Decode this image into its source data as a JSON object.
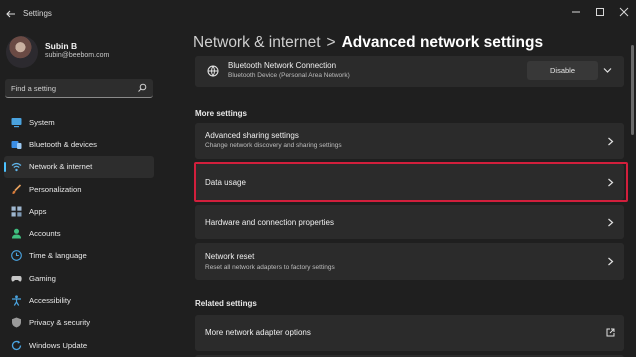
{
  "window": {
    "title": "Settings",
    "back_icon": "back-arrow-icon",
    "controls": [
      "minimize",
      "maximize",
      "close"
    ]
  },
  "profile": {
    "name": "Subin B",
    "email": "subin@beebom.com"
  },
  "search": {
    "placeholder": "Find a setting"
  },
  "sidebar": {
    "items": [
      {
        "label": "System",
        "icon": "monitor-icon",
        "color": "#4aa3df"
      },
      {
        "label": "Bluetooth & devices",
        "icon": "bluetooth-icon",
        "color": "#3a8ee6"
      },
      {
        "label": "Network & internet",
        "icon": "wifi-icon",
        "color": "#5fb3e8",
        "active": true
      },
      {
        "label": "Personalization",
        "icon": "paintbrush-icon",
        "color": "#e8a25f"
      },
      {
        "label": "Apps",
        "icon": "apps-icon",
        "color": "#9fb7cf"
      },
      {
        "label": "Accounts",
        "icon": "person-icon",
        "color": "#3fbf7f"
      },
      {
        "label": "Time & language",
        "icon": "globe-clock-icon",
        "color": "#4aa3df"
      },
      {
        "label": "Gaming",
        "icon": "gamepad-icon",
        "color": "#c7c7c7"
      },
      {
        "label": "Accessibility",
        "icon": "accessibility-icon",
        "color": "#4aa3df"
      },
      {
        "label": "Privacy & security",
        "icon": "shield-icon",
        "color": "#9a9a9a"
      },
      {
        "label": "Windows Update",
        "icon": "update-icon",
        "color": "#4aa3df"
      }
    ]
  },
  "breadcrumb": {
    "parent": "Network & internet",
    "separator": ">",
    "current": "Advanced network settings"
  },
  "adapter": {
    "title": "Bluetooth Network Connection",
    "subtitle": "Bluetooth Device (Personal Area Network)",
    "button": "Disable"
  },
  "more_settings": {
    "heading": "More settings",
    "items": [
      {
        "title": "Advanced sharing settings",
        "subtitle": "Change network discovery and sharing settings"
      },
      {
        "title": "Data usage",
        "subtitle": ""
      },
      {
        "title": "Hardware and connection properties",
        "subtitle": ""
      },
      {
        "title": "Network reset",
        "subtitle": "Reset all network adapters to factory settings"
      }
    ]
  },
  "related_settings": {
    "heading": "Related settings",
    "items": [
      {
        "title": "More network adapter options",
        "icon": "open-external-icon"
      }
    ]
  },
  "colors": {
    "background": "#1f1f1f",
    "card": "#2b2b2b",
    "accent": "#4cc2ff",
    "highlight": "#d21f3c"
  }
}
